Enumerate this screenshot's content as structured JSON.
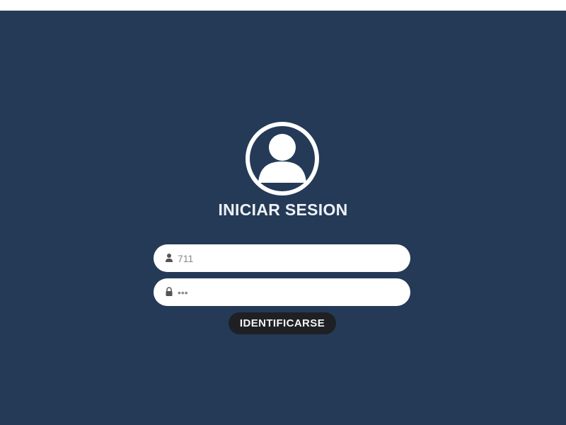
{
  "login": {
    "title": "INICIAR SESION",
    "username": {
      "value": "711",
      "icon": "user-icon"
    },
    "password": {
      "value": "•••",
      "icon": "lock-icon"
    },
    "submit_label": "IDENTIFICARSE",
    "avatar_icon": "user-avatar-icon"
  },
  "colors": {
    "background": "#243a57",
    "field": "#ffffff",
    "button": "#1f2024",
    "title": "#eef1f5"
  }
}
